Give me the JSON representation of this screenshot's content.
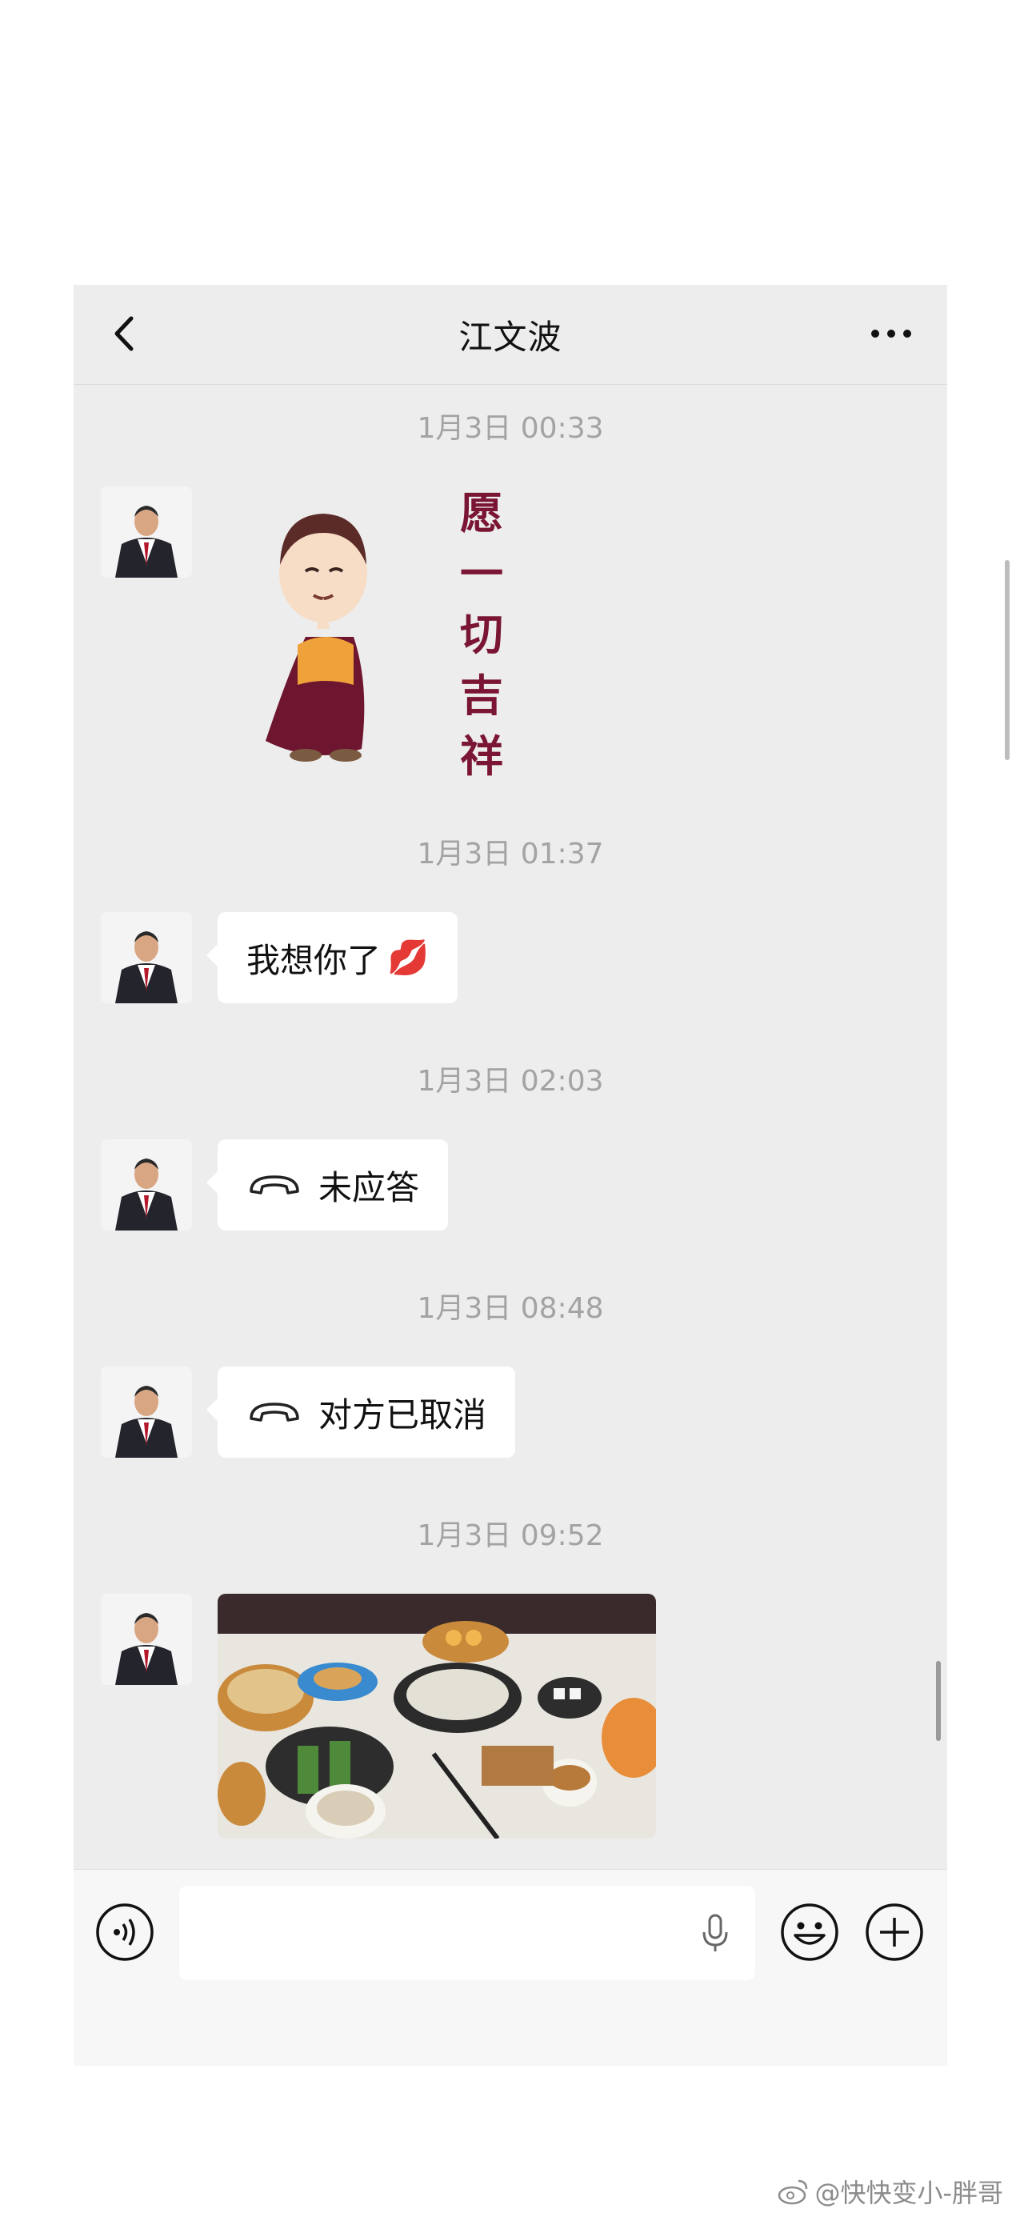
{
  "chat": {
    "title": "江文波",
    "messages": [
      {
        "time": "1月3日 00:33",
        "type": "sticker",
        "sticker_text": "愿一切吉祥"
      },
      {
        "time": "1月3日 01:37",
        "type": "text",
        "text": "我想你了",
        "emoji": "💋"
      },
      {
        "time": "1月3日 02:03",
        "type": "call",
        "text": "未应答"
      },
      {
        "time": "1月3日 08:48",
        "type": "call",
        "text": "对方已取消"
      },
      {
        "time": "1月3日 09:52",
        "type": "image"
      }
    ]
  },
  "icons": {
    "back": "chevron-left-icon",
    "more": "more-icon",
    "voice": "voice-icon",
    "mic": "microphone-icon",
    "emoji": "emoji-icon",
    "add": "plus-icon",
    "call": "phone-icon"
  },
  "watermark": "@快快变小-胖哥",
  "colors": {
    "background": "#ededed",
    "bubble": "#ffffff",
    "timestamp": "#a3a3a3",
    "sticker_text": "#7a1533"
  }
}
